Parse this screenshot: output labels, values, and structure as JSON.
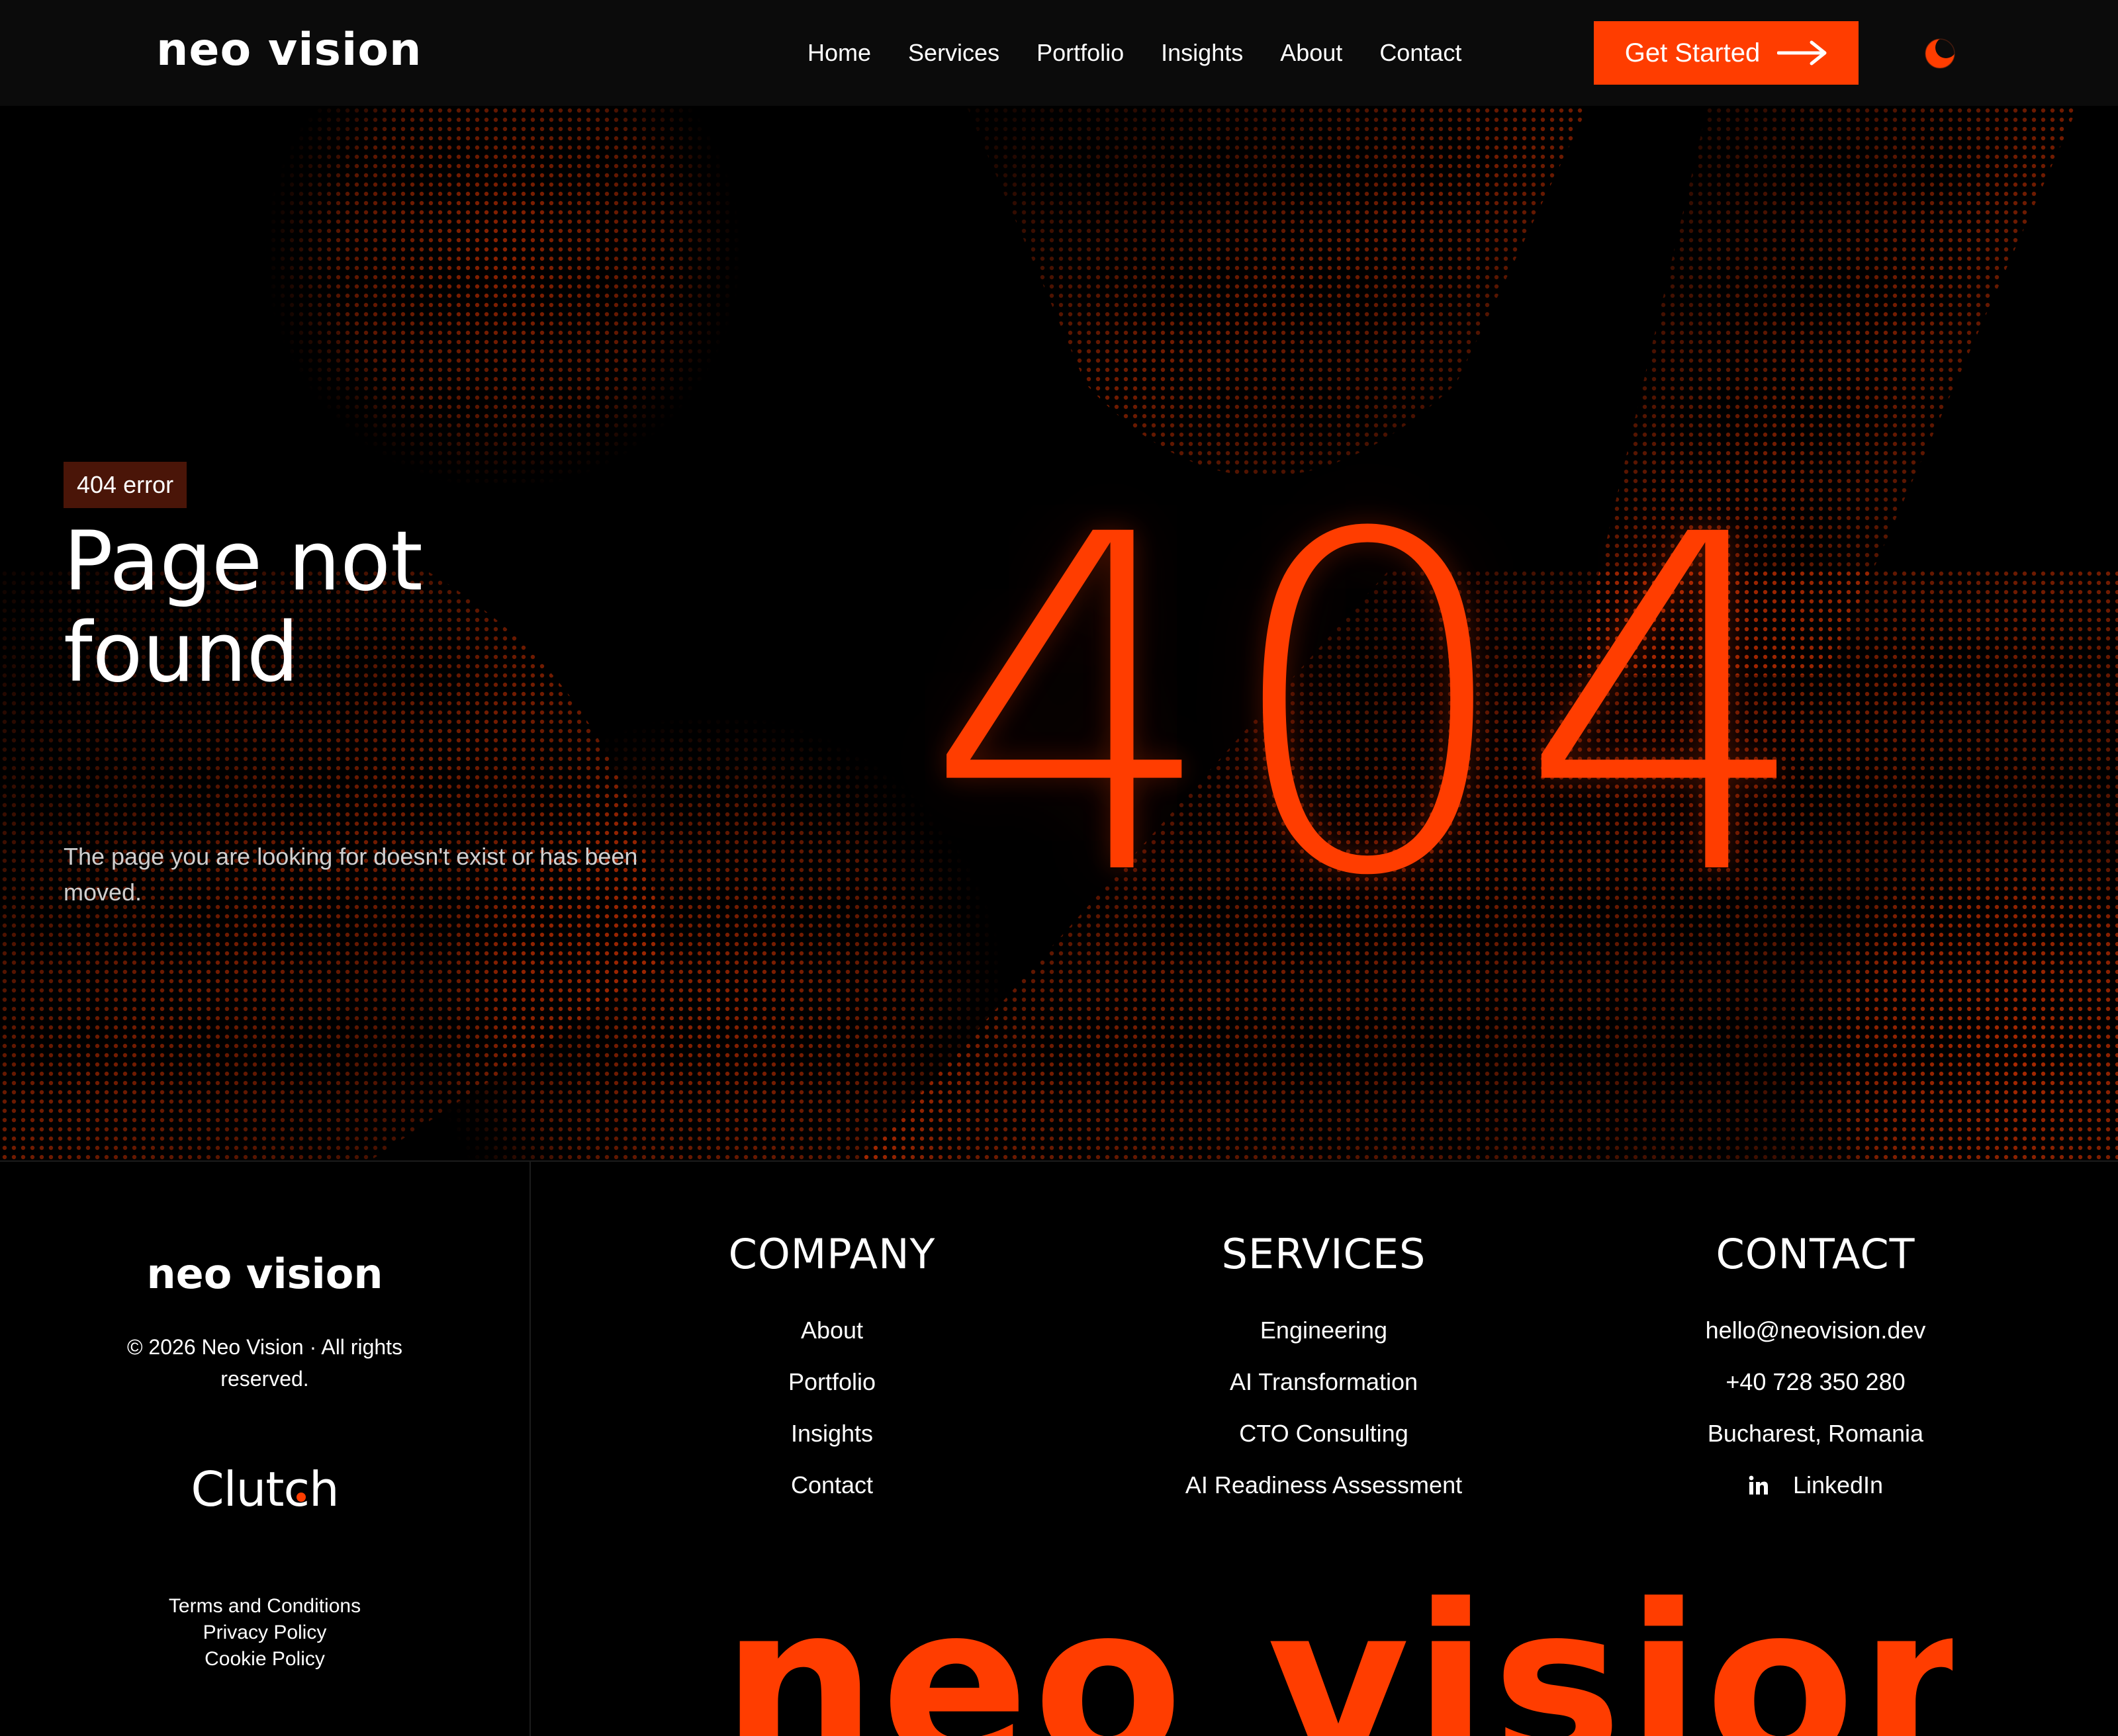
{
  "header": {
    "logo": "neo vision",
    "nav": [
      "Home",
      "Services",
      "Portfolio",
      "Insights",
      "About",
      "Contact"
    ],
    "cta_label": "Get Started",
    "cta_icon": "arrow-right-icon",
    "theme_icon": "moon-icon"
  },
  "hero": {
    "badge": "404 error",
    "title": "Page not found",
    "subtitle": "The page you are looking for doesn't exist or has been moved.",
    "code": "404"
  },
  "footer": {
    "logo": "neo vision",
    "copyright": "© 2026 Neo Vision · All rights reserved.",
    "clutch": "Clutch",
    "legal": [
      "Terms and Conditions",
      "Privacy Policy",
      "Cookie Policy"
    ],
    "columns": {
      "company": {
        "title": "COMPANY",
        "items": [
          "About",
          "Portfolio",
          "Insights",
          "Contact"
        ]
      },
      "services": {
        "title": "SERVICES",
        "items": [
          "Engineering",
          "AI Transformation",
          "CTO Consulting",
          "AI Readiness Assessment"
        ]
      },
      "contact": {
        "title": "CONTACT",
        "email": "hello@neovision.dev",
        "phone": "+40 728 350 280",
        "location": "Bucharest, Romania",
        "linkedin": "LinkedIn"
      }
    },
    "wordmark": "neo vision"
  },
  "colors": {
    "accent": "#ff3d00",
    "background": "#000000",
    "header_bg": "#0b0b0b",
    "badge_bg": "#4a1508"
  }
}
